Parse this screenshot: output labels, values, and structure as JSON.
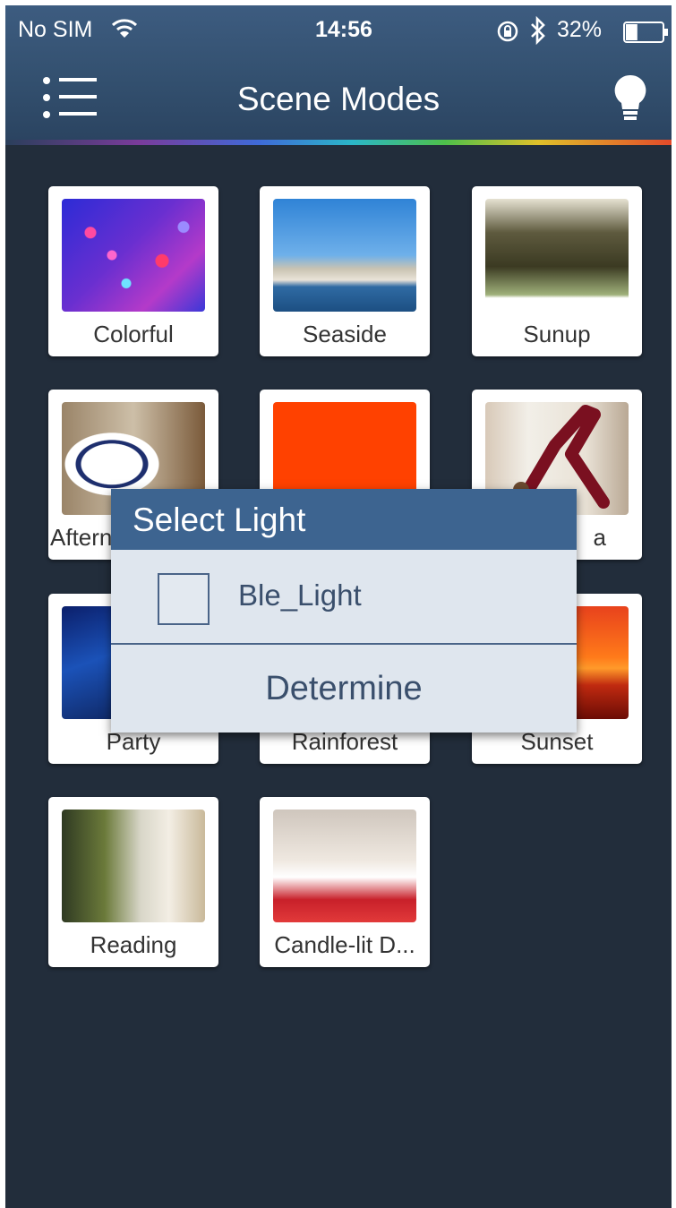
{
  "status_bar": {
    "carrier": "No SIM",
    "time": "14:56",
    "battery_percent": "32%",
    "battery_level": 0.32,
    "icons": [
      "wifi-icon",
      "rotation-lock-icon",
      "bluetooth-icon",
      "battery-icon"
    ]
  },
  "nav": {
    "title": "Scene Modes",
    "left_icon": "menu-list-icon",
    "right_icon": "light-bulb-icon"
  },
  "scenes": [
    {
      "label": "Colorful"
    },
    {
      "label": "Seaside"
    },
    {
      "label": "Sunup"
    },
    {
      "label": "Aftern"
    },
    {
      "label": ""
    },
    {
      "label": "a"
    },
    {
      "label": "Party"
    },
    {
      "label": "Rainforest"
    },
    {
      "label": "Sunset"
    },
    {
      "label": "Reading"
    },
    {
      "label": "Candle-lit D..."
    }
  ],
  "dialog": {
    "title": "Select Light",
    "light_name": "Ble_Light",
    "light_checked": false,
    "confirm_label": "Determine"
  },
  "colors": {
    "background": "#222d3b",
    "nav_bar": "#33506f",
    "dialog_header": "#3d6490",
    "dialog_body": "#dfe6ee",
    "orange_scene": "#ff4100"
  }
}
